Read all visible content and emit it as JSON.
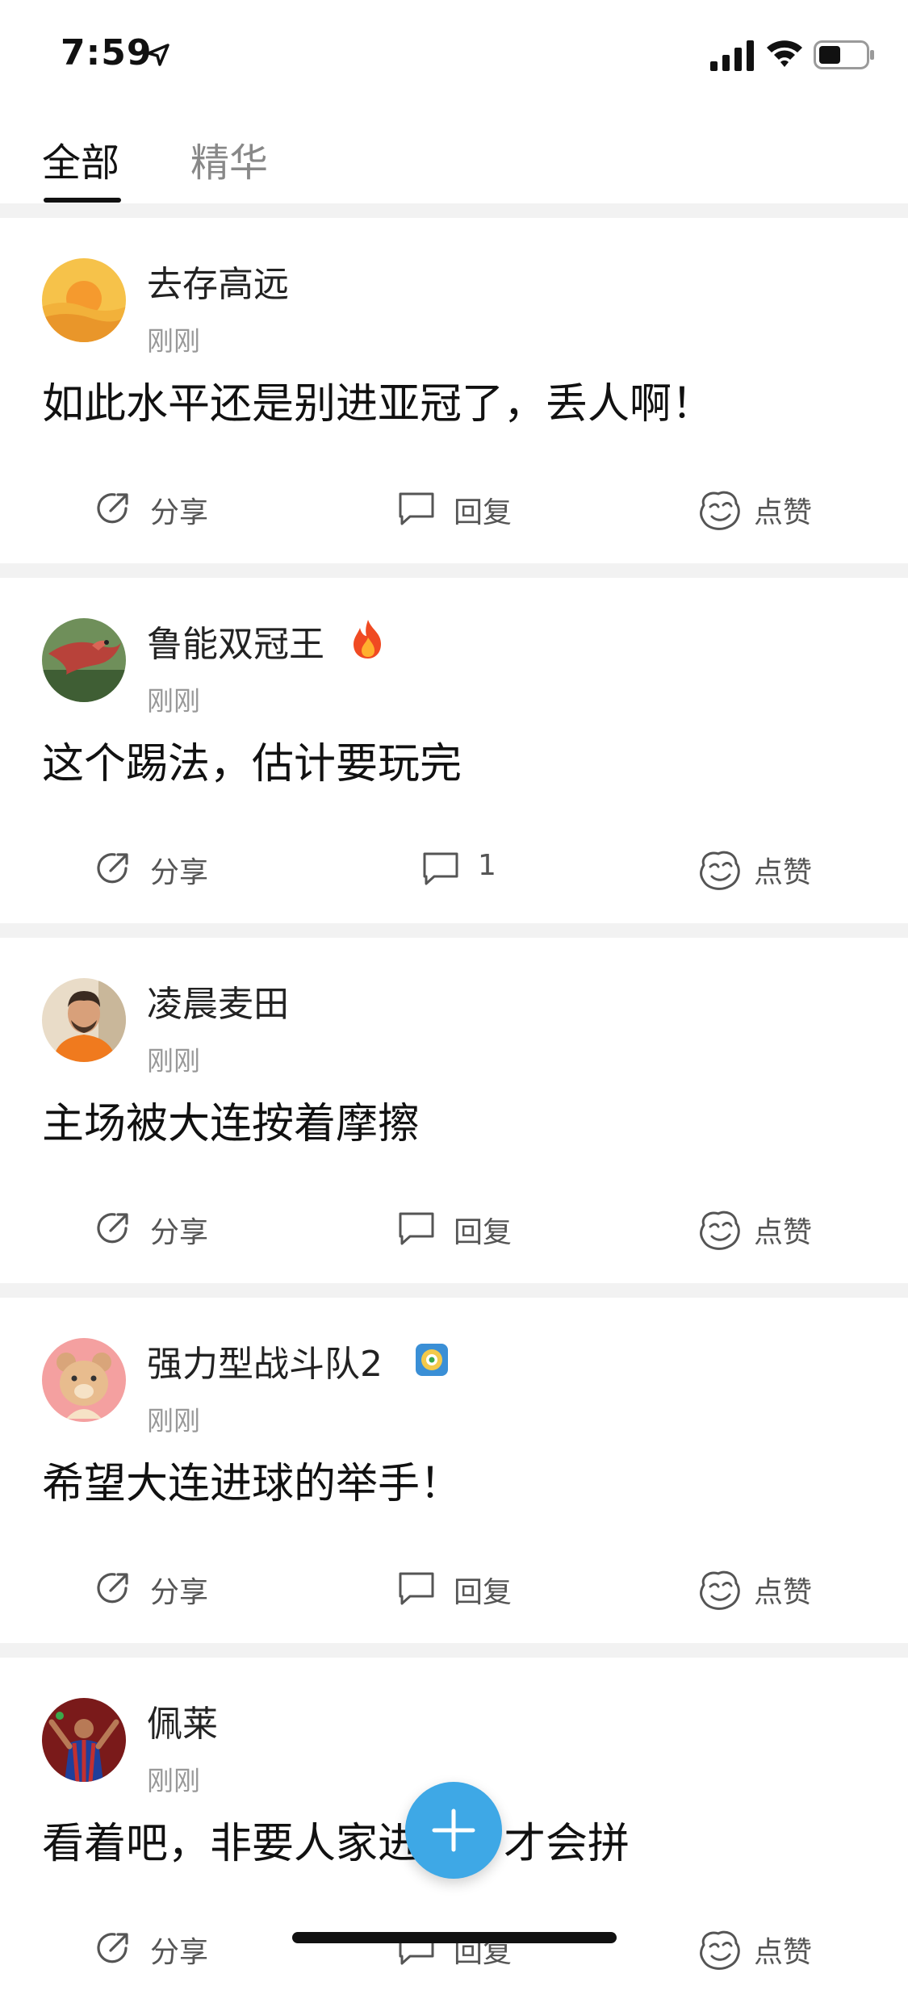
{
  "status_bar": {
    "time": "7:59"
  },
  "tabs": [
    {
      "label": "全部",
      "active": true
    },
    {
      "label": "精华",
      "active": false
    }
  ],
  "actions": {
    "share": "分享",
    "reply": "回复",
    "like": "点赞"
  },
  "posts": [
    {
      "username": "去存高远",
      "time": "刚刚",
      "content": "如此水平还是别进亚冠了，丢人啊！",
      "reply_label": "回复",
      "badge": null
    },
    {
      "username": "鲁能双冠王",
      "time": "刚刚",
      "content": "这个踢法，估计要玩完",
      "reply_label": "1",
      "badge": "fire-icon"
    },
    {
      "username": "凌晨麦田",
      "time": "刚刚",
      "content": "主场被大连按着摩擦",
      "reply_label": "回复",
      "badge": null
    },
    {
      "username": "强力型战斗队2",
      "time": "刚刚",
      "content": "希望大连进球的举手！",
      "reply_label": "回复",
      "badge": "medal-icon"
    },
    {
      "username": "佩莱",
      "time": "刚刚",
      "content": "看着吧，非要人家进个，才会拼",
      "reply_label": "回复",
      "badge": null
    }
  ],
  "colors": {
    "accent": "#3ea8e6",
    "divider": "#f2f2f2",
    "muted": "#999999"
  }
}
